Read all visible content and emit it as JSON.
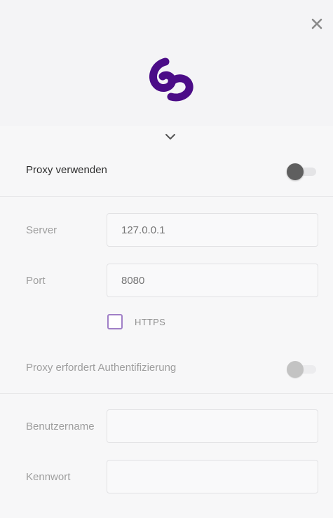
{
  "header": {
    "close_icon": "close-icon",
    "logo_icon": "swirl-logo-icon",
    "brand_color": "#4b0c87"
  },
  "expand": {
    "icon": "chevron-down-icon"
  },
  "proxy": {
    "label": "Proxy verwenden",
    "enabled": false
  },
  "server": {
    "label": "Server",
    "placeholder": "127.0.0.1",
    "value": ""
  },
  "port": {
    "label": "Port",
    "placeholder": "8080",
    "value": ""
  },
  "https": {
    "label": "HTTPS",
    "checked": false,
    "accent": "#a07fc7"
  },
  "auth": {
    "label": "Proxy erfordert Authentifizierung",
    "enabled": false
  },
  "username": {
    "label": "Benutzername",
    "value": ""
  },
  "password": {
    "label": "Kennwort",
    "value": ""
  }
}
